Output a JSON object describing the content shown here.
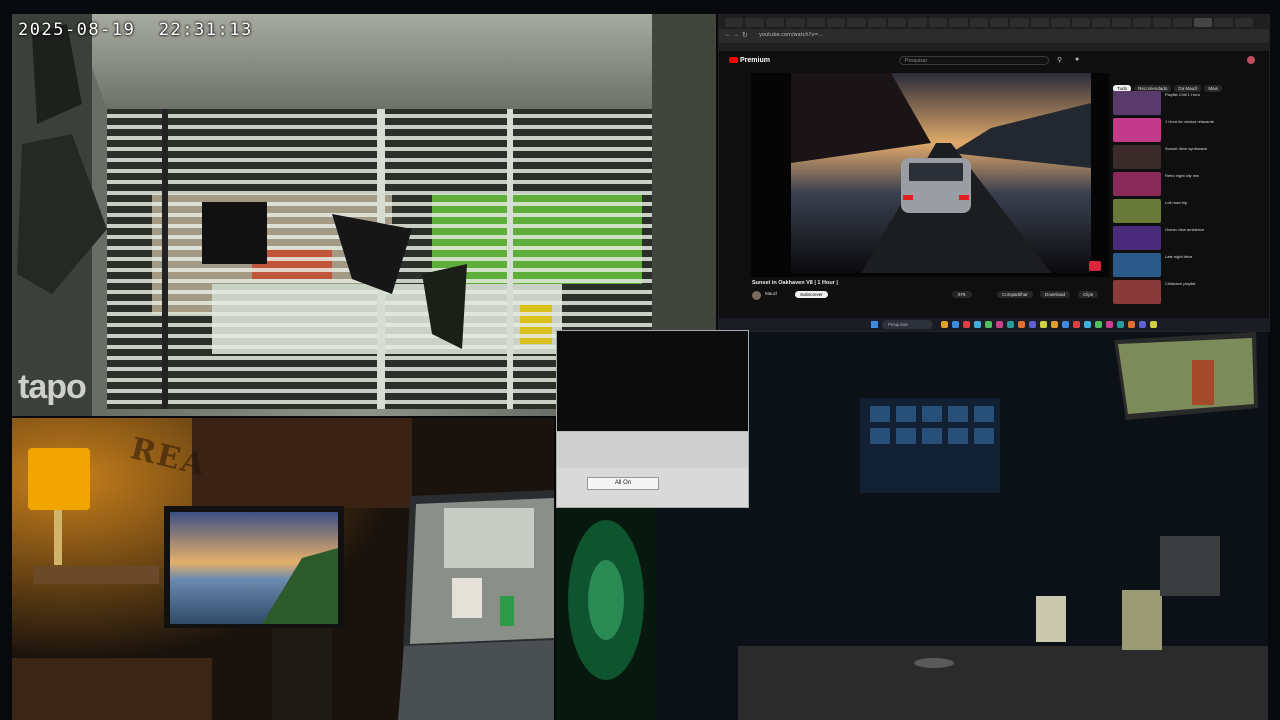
{
  "camera_feed_1": {
    "timestamp": "2025-08-19  22:31:13",
    "brand_watermark": "tapo"
  },
  "room_feed_1": {
    "wall_text": "REA"
  },
  "browser": {
    "tabs_count": 26,
    "url": "youtube.com/watch?v=…",
    "youtube": {
      "logo": "Premium",
      "search_placeholder": "Pesquisar",
      "video_title": "Sunset in Oakhaven V8 | 1 Hour |",
      "channel_name": "Mauzl",
      "subscribe_label": "Subscrever",
      "like_label": "976",
      "share_label": "Compartilhar",
      "download_label": "Download",
      "clip_label": "Clipe",
      "filter_chips": [
        "Tudo",
        "Recomendado",
        "Da Mauzl",
        "Mais"
      ],
      "recommendations": [
        {
          "title": "Playlist Chill 1 Hora",
          "channel": "",
          "meta": ""
        },
        {
          "title": "1 Hora de música relaxante",
          "channel": "",
          "meta": ""
        },
        {
          "title": "Sunset drive synthwave",
          "channel": "",
          "meta": ""
        },
        {
          "title": "Retro night city mix",
          "channel": "",
          "meta": ""
        },
        {
          "title": "Lofi road trip",
          "channel": "",
          "meta": ""
        },
        {
          "title": "Ocean view ambience",
          "channel": "",
          "meta": ""
        },
        {
          "title": "Late night drive",
          "channel": "",
          "meta": ""
        },
        {
          "title": "Chillwave playlist",
          "channel": "",
          "meta": ""
        }
      ]
    },
    "taskbar": {
      "search_label": "Pesquisar"
    }
  },
  "dialog": {
    "button_label": "All On"
  },
  "colors": {
    "youtube_red": "#ff0000",
    "lamp_glow": "#f2a500",
    "green_glow": "#1ec46a"
  }
}
